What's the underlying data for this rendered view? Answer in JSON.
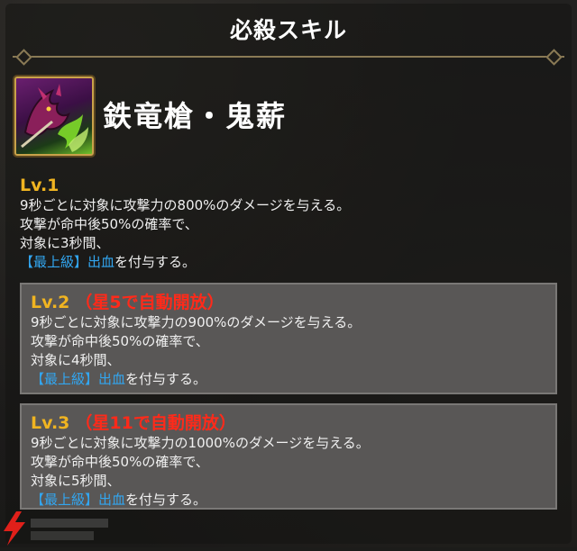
{
  "header": {
    "title": "必殺スキル"
  },
  "skill": {
    "name": "鉄竜槍・鬼薪"
  },
  "levels": [
    {
      "label": "Lv.1",
      "unlock": "",
      "line1": "9秒ごとに対象に攻撃力の800%のダメージを与える。",
      "line2": "攻撃が命中後50%の確率で、",
      "line3": "対象に3秒間、",
      "tag": "【最上級】",
      "effect": "出血",
      "suffix": "を付与する。"
    },
    {
      "label": "Lv.2",
      "unlock": "（星5で自動開放）",
      "line1": "9秒ごとに対象に攻撃力の900%のダメージを与える。",
      "line2": "攻撃が命中後50%の確率で、",
      "line3": "対象に4秒間、",
      "tag": "【最上級】",
      "effect": "出血",
      "suffix": "を付与する。"
    },
    {
      "label": "Lv.3",
      "unlock": "（星11で自動開放）",
      "line1": "9秒ごとに対象に攻撃力の1000%のダメージを与える。",
      "line2": "攻撃が命中後50%の確率で、",
      "line3": "対象に5秒間、",
      "tag": "【最上級】",
      "effect": "出血",
      "suffix": "を付与する。"
    }
  ],
  "colors": {
    "level_heading": "#f0b421",
    "unlock_text": "#ff2a1a",
    "effect_text": "#32a6f0",
    "frame_gold": "#c9a24a"
  },
  "icons": {
    "skill": "dragon-skill-icon",
    "logo": "lightning-bolt-icon"
  }
}
